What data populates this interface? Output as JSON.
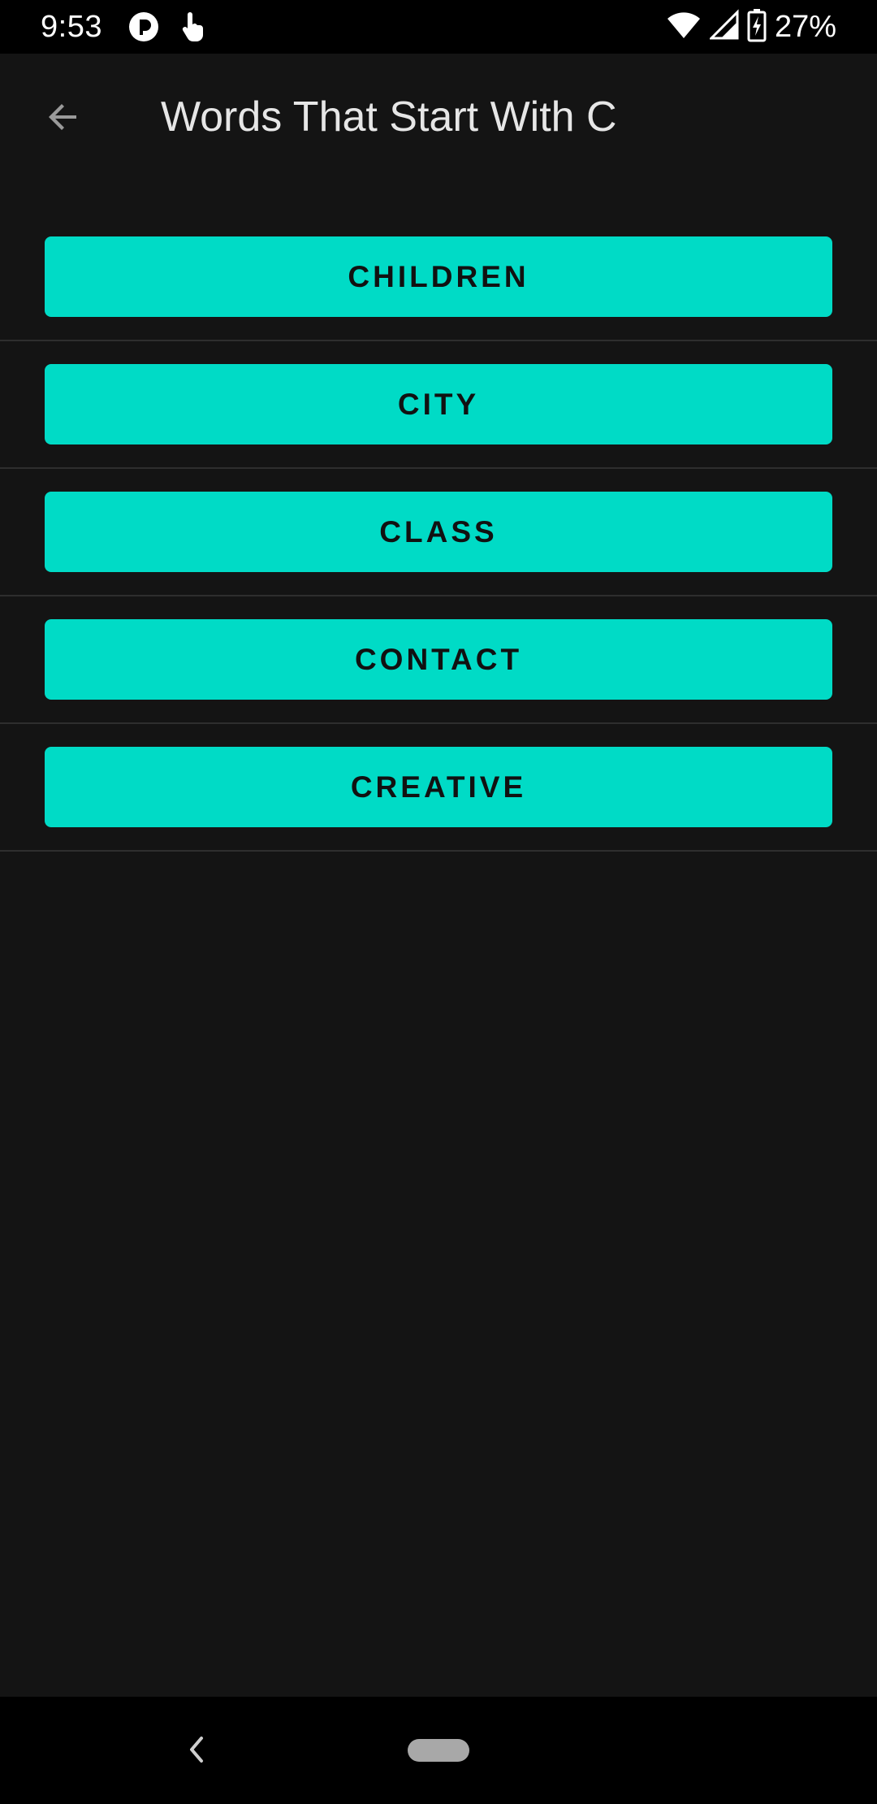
{
  "status_bar": {
    "time": "9:53",
    "battery": "27%",
    "icons": [
      "notification-app-icon",
      "touch-gesture-icon",
      "wifi-icon",
      "cell-signal-icon",
      "battery-charging-icon"
    ]
  },
  "app_bar": {
    "title": "Words That Start With C",
    "back_icon": "arrow-back-icon"
  },
  "words": [
    {
      "label": "CHILDREN"
    },
    {
      "label": "CITY"
    },
    {
      "label": "CLASS"
    },
    {
      "label": "CONTACT"
    },
    {
      "label": "CREATIVE"
    }
  ],
  "nav_bar": {
    "back_icon": "chevron-left-icon",
    "home_icon": "home-pill-icon"
  },
  "colors": {
    "background": "#141414",
    "accent": "#00dbc6",
    "button_text": "#111111",
    "title_text": "#e6e6e6",
    "divider": "#2e2e2e"
  }
}
